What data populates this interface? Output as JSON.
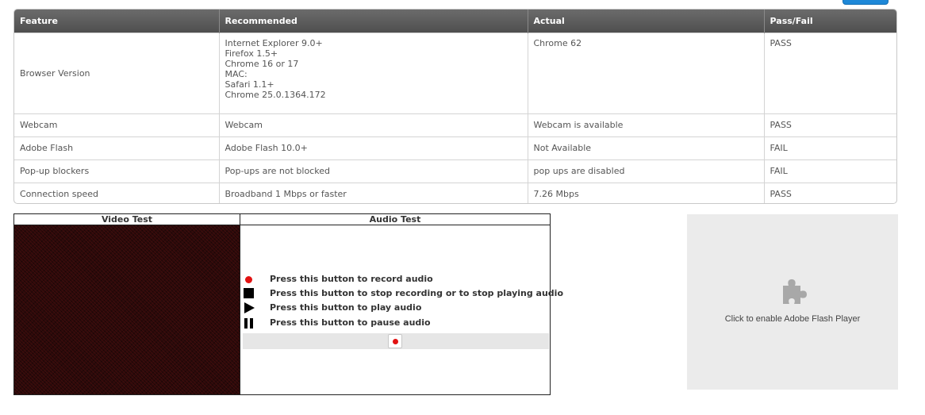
{
  "table": {
    "headers": [
      "Feature",
      "Recommended",
      "Actual",
      "Pass/Fail"
    ],
    "rows": [
      {
        "feature": "Browser Version",
        "recommended": [
          "Internet Explorer 9.0+",
          "Firefox 1.5+",
          "Chrome 16 or 17",
          "MAC:",
          "Safari 1.1+",
          "Chrome 25.0.1364.172"
        ],
        "actual": "Chrome 62",
        "result": "PASS"
      },
      {
        "feature": "Webcam",
        "recommended": "Webcam",
        "actual": "Webcam is available",
        "result": "PASS"
      },
      {
        "feature": "Adobe Flash",
        "recommended": "Adobe Flash 10.0+",
        "actual": "Not Available",
        "result": "FAIL"
      },
      {
        "feature": "Pop-up blockers",
        "recommended": "Pop-ups are not blocked",
        "actual": "pop ups are disabled",
        "result": "FAIL"
      },
      {
        "feature": "Connection speed",
        "recommended": "Broadband 1 Mbps or faster",
        "actual": "7.26 Mbps",
        "result": "PASS"
      }
    ]
  },
  "av_test": {
    "video_header": "Video Test",
    "audio_header": "Audio Test",
    "legend": {
      "record": "Press this button to record audio",
      "stop": "Press this button to stop recording or to stop playing audio",
      "play": "Press this button to play audio",
      "pause": "Press this button to pause audio"
    },
    "icons": {
      "record": "record-icon",
      "stop": "stop-icon",
      "play": "play-icon",
      "pause": "pause-icon"
    }
  },
  "flash_placeholder": {
    "text": "Click to enable Adobe Flash Player",
    "icon": "puzzle-plugin-icon"
  },
  "colors": {
    "pass": "#2e8b2e",
    "fail": "#e01a1a",
    "header_bg": "#5a5a5a",
    "record": "#e21212",
    "flash_bg": "#ebebeb"
  }
}
